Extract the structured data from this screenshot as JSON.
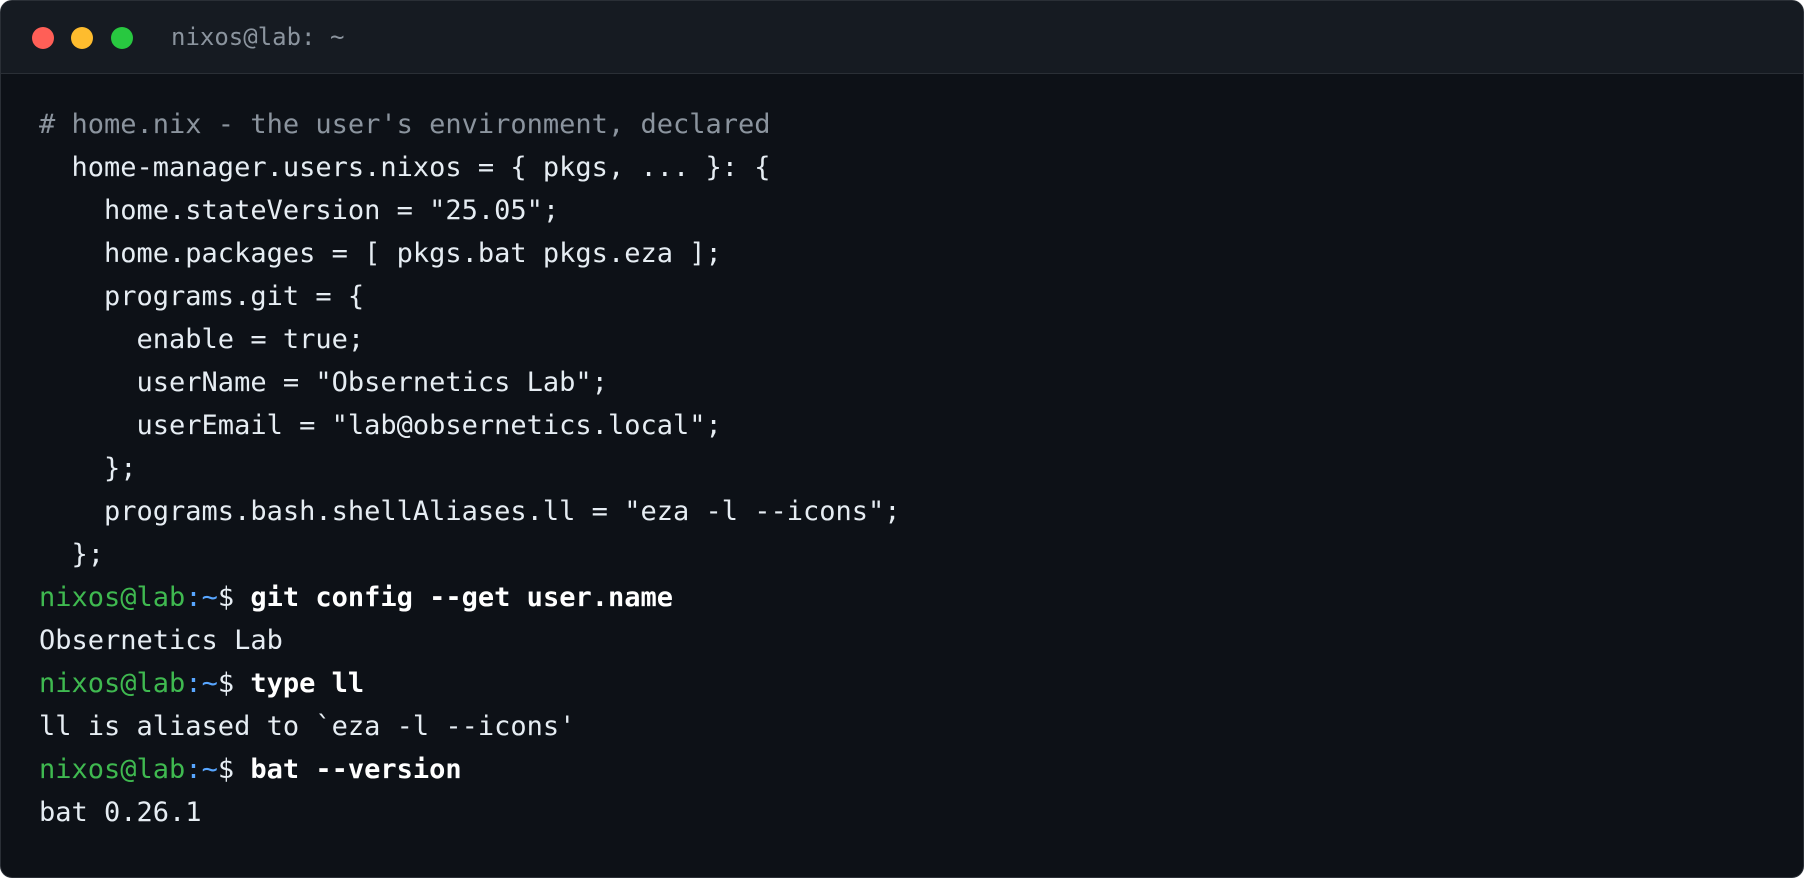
{
  "window": {
    "title": "nixos@lab: ~"
  },
  "terminal": {
    "code_lines": [
      "# home.nix - the user's environment, declared",
      "  home-manager.users.nixos = { pkgs, ... }: {",
      "    home.stateVersion = \"25.05\";",
      "    home.packages = [ pkgs.bat pkgs.eza ];",
      "    programs.git = {",
      "      enable = true;",
      "      userName = \"Obsernetics Lab\";",
      "      userEmail = \"lab@obsernetics.local\";",
      "    };",
      "    programs.bash.shellAliases.ll = \"eza -l --icons\";",
      "  };"
    ],
    "prompt": {
      "user_host": "nixos@lab",
      "path": ":~",
      "symbol": "$ "
    },
    "commands": [
      {
        "command": "git config --get user.name",
        "output": "Obsernetics Lab"
      },
      {
        "command": "type ll",
        "output": "ll is aliased to `eza -l --icons'"
      },
      {
        "command": "bat --version",
        "output": "bat 0.26.1"
      }
    ]
  },
  "colors": {
    "background": "#0d1117",
    "titlebar": "#161b22",
    "prompt_user": "#3fb950",
    "prompt_path": "#58a6ff",
    "comment": "#8b949e",
    "text": "#e6edf3"
  }
}
